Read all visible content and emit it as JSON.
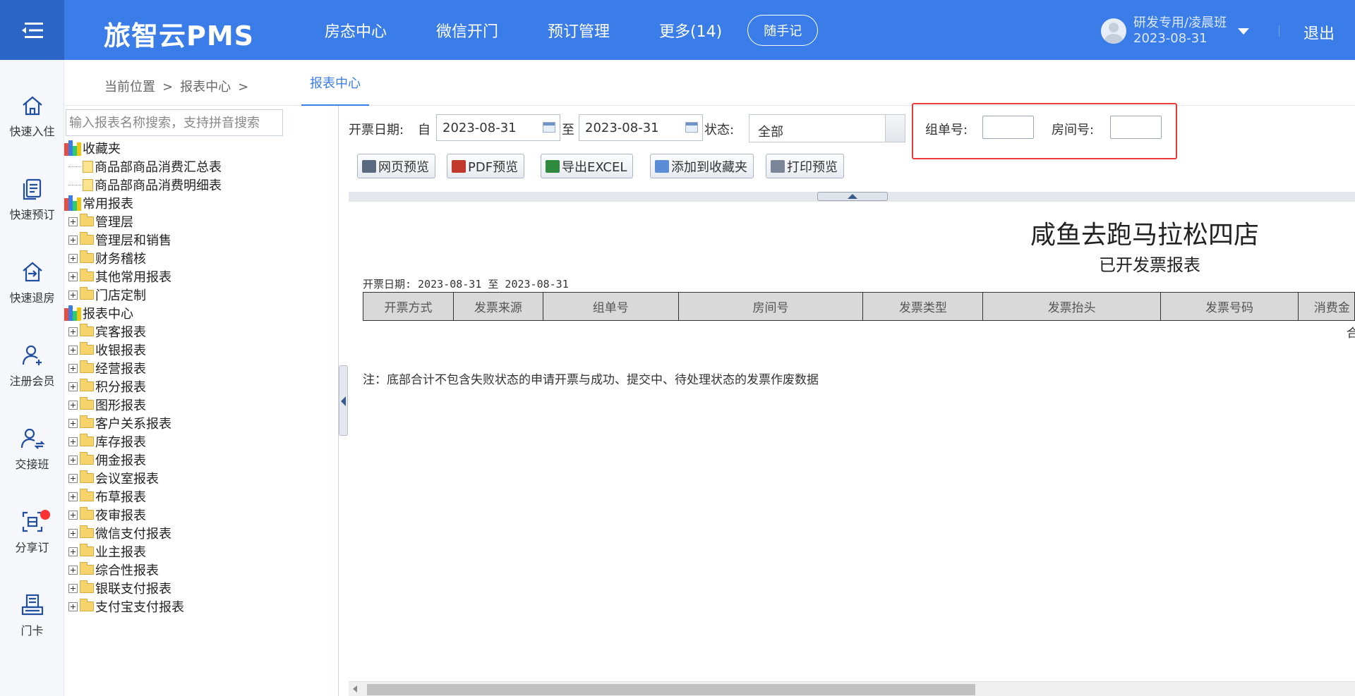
{
  "header": {
    "logo": "旅智云PMS",
    "nav": [
      "房态中心",
      "微信开门",
      "预订管理",
      "更多(14)"
    ],
    "memo_button": "随手记",
    "user_name": "研发专用/凌晨班",
    "user_date": "2023-08-31",
    "logout": "退出"
  },
  "rail": [
    "快速入住",
    "快速预订",
    "快速退房",
    "注册会员",
    "交接班",
    "分享订",
    "门卡"
  ],
  "breadcrumb": {
    "label": "当前位置",
    "sep": ">",
    "item": "报表中心",
    "sep2": ">"
  },
  "active_tab": "报表中心",
  "tree": {
    "search_placeholder": "输入报表名称搜索，支持拼音搜索",
    "favorites": {
      "label": "收藏夹",
      "items": [
        "商品部商品消费汇总表",
        "商品部商品消费明细表"
      ]
    },
    "common": {
      "label": "常用报表",
      "items": [
        "管理层",
        "管理层和销售",
        "财务稽核",
        "其他常用报表",
        "门店定制"
      ]
    },
    "center": {
      "label": "报表中心",
      "items": [
        "宾客报表",
        "收银报表",
        "经营报表",
        "积分报表",
        "图形报表",
        "客户关系报表",
        "库存报表",
        "佣金报表",
        "会议室报表",
        "布草报表",
        "夜审报表",
        "微信支付报表",
        "业主报表",
        "综合性报表",
        "银联支付报表",
        "支付宝支付报表"
      ]
    }
  },
  "filter": {
    "date_label": "开票日期:",
    "from_label": "自",
    "date_from": "2023-08-31",
    "to_label": "至",
    "date_to": "2023-08-31",
    "status_label": "状态:",
    "status_value": "全部",
    "group_label": "组单号:",
    "room_label": "房间号:"
  },
  "toolbar": [
    "网页预览",
    "PDF预览",
    "导出EXCEL",
    "添加到收藏夹",
    "打印预览"
  ],
  "report": {
    "hotel": "咸鱼去跑马拉松四店",
    "title": "已开发票报表",
    "date_range": "开票日期: 2023-08-31 至 2023-08-31",
    "columns": [
      "开票方式",
      "发票来源",
      "组单号",
      "房间号",
      "发票类型",
      "发票抬头",
      "发票号码",
      "消费金"
    ],
    "sum_partial": "合",
    "note": "注：底部合计不包含失败状态的申请开票与成功、提交中、待处理状态的发票作废数据"
  }
}
